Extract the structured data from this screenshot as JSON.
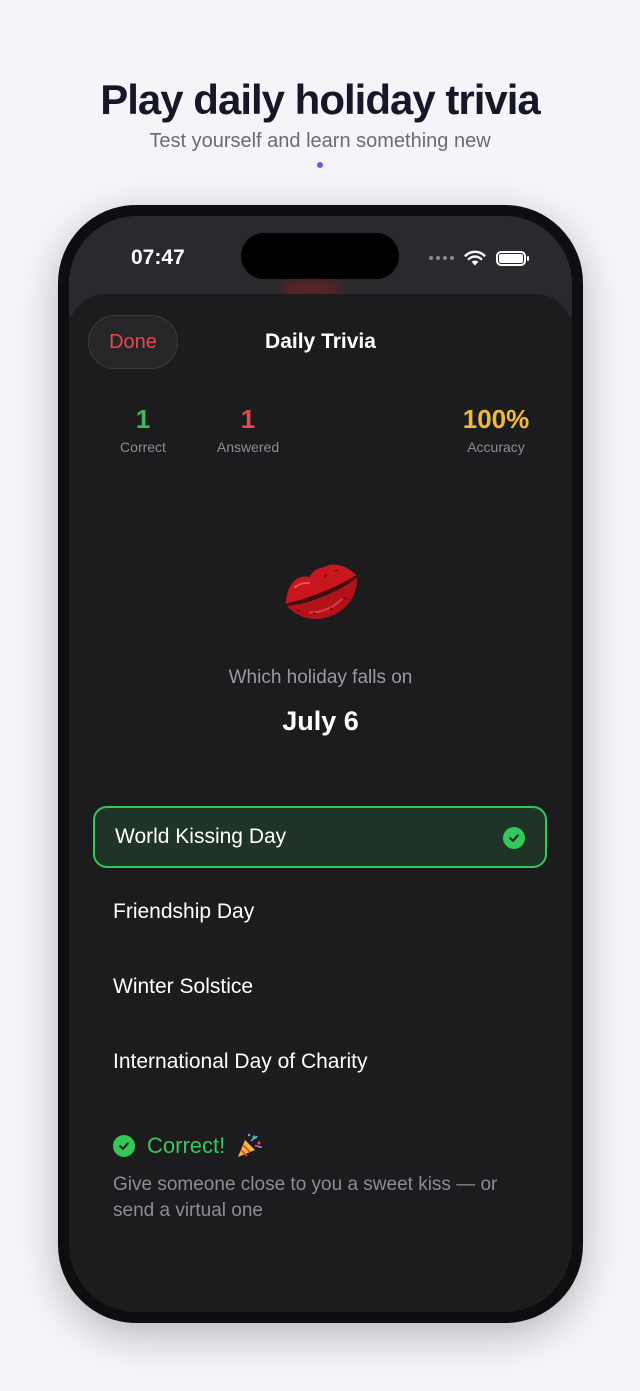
{
  "promo": {
    "title": "Play daily holiday trivia",
    "subtitle": "Test yourself and learn something new",
    "accent": "#7b55d6"
  },
  "status_bar": {
    "time": "07:47",
    "icons": [
      "signal-dots-icon",
      "wifi-icon",
      "battery-icon"
    ]
  },
  "sheet": {
    "done_label": "Done",
    "title": "Daily Trivia"
  },
  "stats": {
    "correct": {
      "value": "1",
      "label": "Correct",
      "color": "#3dbb5c"
    },
    "answered": {
      "value": "1",
      "label": "Answered",
      "color": "#e5484d"
    },
    "accuracy": {
      "value": "100%",
      "label": "Accuracy",
      "color": "#f1b93a"
    }
  },
  "question": {
    "icon": "kiss-lips-icon",
    "prompt": "Which holiday falls on",
    "date": "July 6"
  },
  "options": [
    {
      "label": "World Kissing Day",
      "selected": true,
      "correct": true
    },
    {
      "label": "Friendship Day",
      "selected": false
    },
    {
      "label": "Winter Solstice",
      "selected": false
    },
    {
      "label": "International Day of Charity",
      "selected": false
    }
  ],
  "result": {
    "label": "Correct!",
    "icon": "party-popper-icon",
    "description": "Give someone close to you a sweet kiss — or send a virtual one",
    "color": "#34c759"
  }
}
